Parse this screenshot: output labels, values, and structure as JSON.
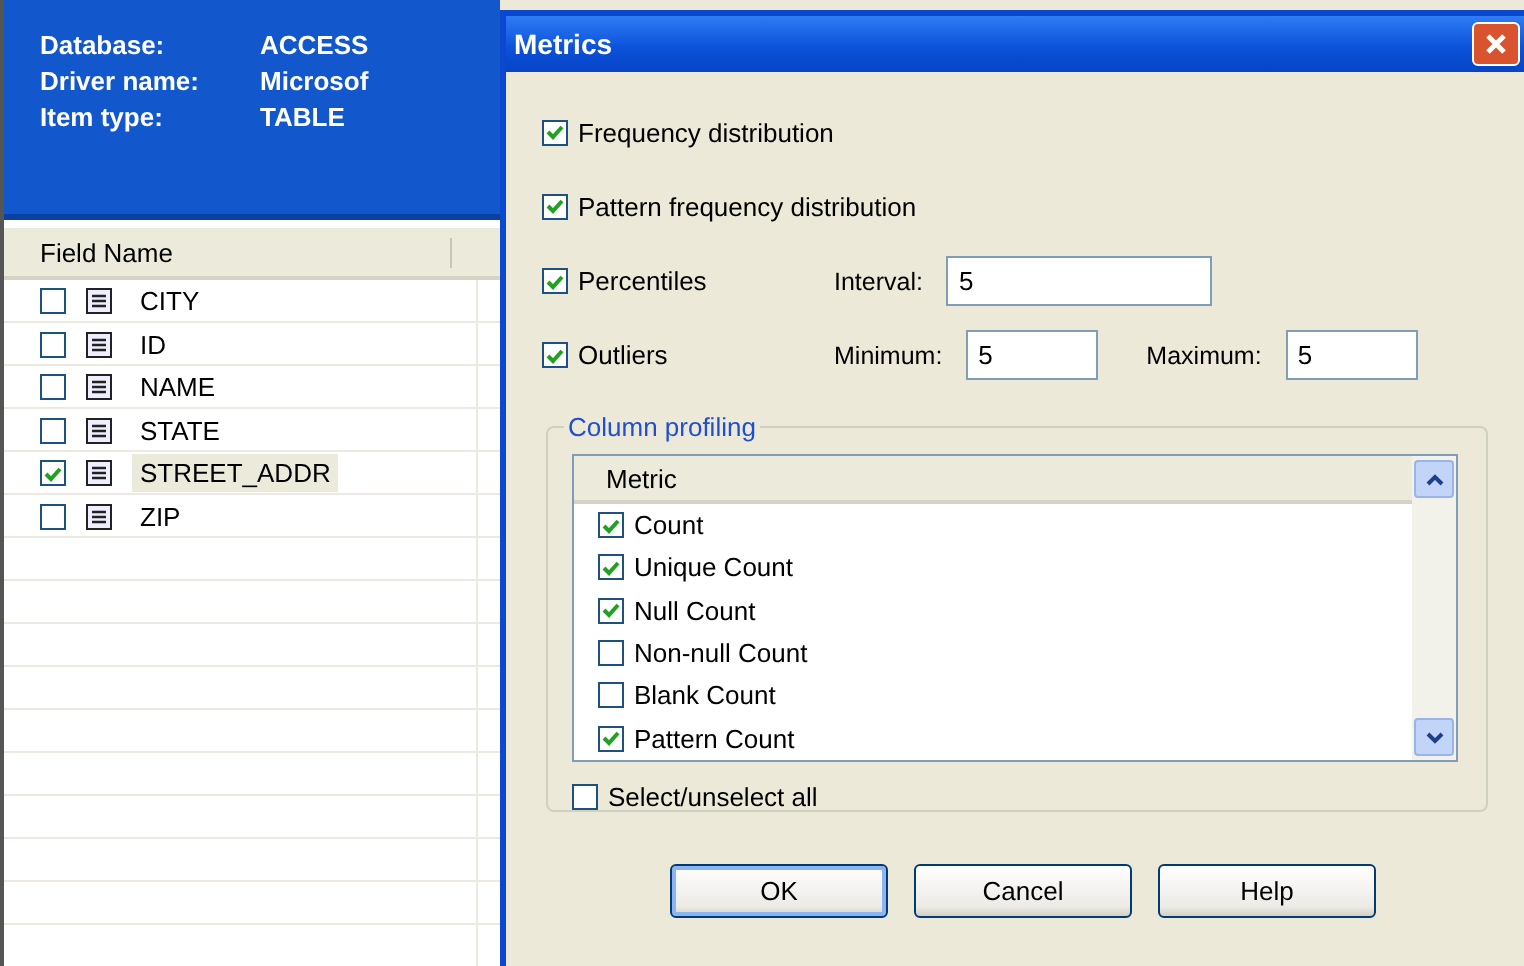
{
  "background_window": {
    "info": [
      {
        "label": "Database:",
        "value": "ACCESS"
      },
      {
        "label": "Driver name:",
        "value": "Microsof"
      },
      {
        "label": "Item type:",
        "value": "TABLE"
      }
    ],
    "table": {
      "columns": [
        "Field Name"
      ],
      "rows": [
        {
          "name": "CITY",
          "checked": false,
          "selected": false
        },
        {
          "name": "ID",
          "checked": false,
          "selected": false
        },
        {
          "name": "NAME",
          "checked": false,
          "selected": false
        },
        {
          "name": "STATE",
          "checked": false,
          "selected": false
        },
        {
          "name": "STREET_ADDR",
          "checked": true,
          "selected": true
        },
        {
          "name": "ZIP",
          "checked": false,
          "selected": false
        }
      ]
    }
  },
  "dialog": {
    "title": "Metrics",
    "options": [
      {
        "label": "Frequency distribution",
        "checked": true
      },
      {
        "label": "Pattern frequency distribution",
        "checked": true
      },
      {
        "label": "Percentiles",
        "checked": true,
        "fields": [
          {
            "label": "Interval:",
            "value": "5",
            "kind": "wide"
          }
        ]
      },
      {
        "label": "Outliers",
        "checked": true,
        "fields": [
          {
            "label": "Minimum:",
            "value": "5",
            "kind": "narrow"
          },
          {
            "label": "Maximum:",
            "value": "5",
            "kind": "narrow"
          }
        ]
      }
    ],
    "column_profiling": {
      "title": "Column profiling",
      "column": "Metric",
      "metrics": [
        {
          "label": "Count",
          "checked": true
        },
        {
          "label": "Unique Count",
          "checked": true
        },
        {
          "label": "Null Count",
          "checked": true
        },
        {
          "label": "Non-null Count",
          "checked": false
        },
        {
          "label": "Blank Count",
          "checked": false
        },
        {
          "label": "Pattern Count",
          "checked": true
        }
      ],
      "select_all": {
        "label": "Select/unselect all",
        "checked": false
      }
    },
    "buttons": [
      "OK",
      "Cancel",
      "Help"
    ]
  }
}
